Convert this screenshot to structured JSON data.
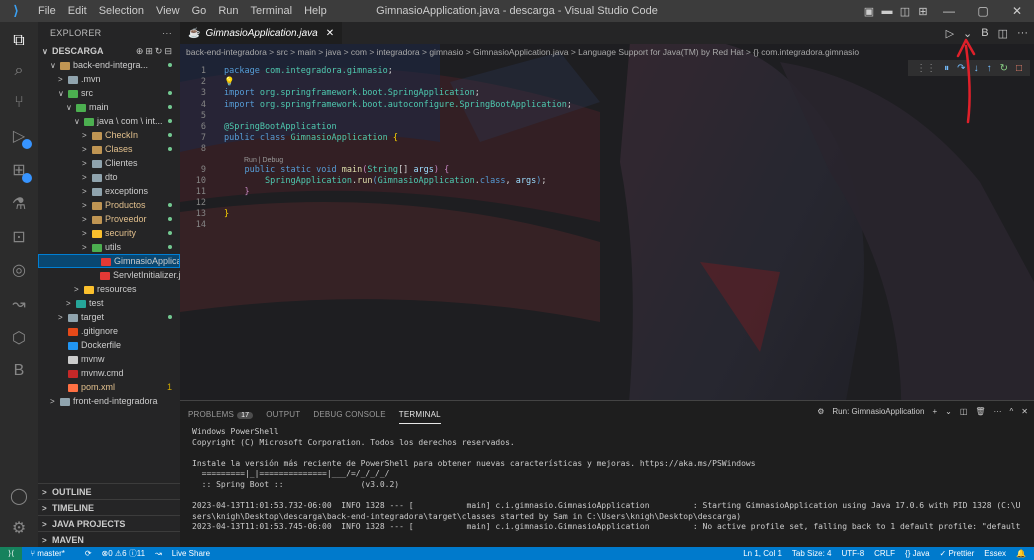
{
  "titlebar": {
    "menu": [
      "File",
      "Edit",
      "Selection",
      "View",
      "Go",
      "Run",
      "Terminal",
      "Help"
    ],
    "title": "GimnasioApplication.java - descarga - Visual Studio Code"
  },
  "sidebar": {
    "header": "EXPLORER",
    "more": "···",
    "tree": [
      {
        "label": "DESCARGA",
        "depth": 0,
        "chev": "∨",
        "section": true
      },
      {
        "label": "back-end-integra...",
        "depth": 1,
        "chev": "∨",
        "icon": "#c09553",
        "dot": true
      },
      {
        "label": ".mvn",
        "depth": 2,
        "chev": ">",
        "icon": "#90a4ae"
      },
      {
        "label": "src",
        "depth": 2,
        "chev": "∨",
        "icon": "#4caf50",
        "dot": true
      },
      {
        "label": "main",
        "depth": 3,
        "chev": "∨",
        "icon": "#4caf50",
        "dot": true
      },
      {
        "label": "java \\ com \\ int...",
        "depth": 4,
        "chev": "∨",
        "icon": "#4caf50",
        "dot": true
      },
      {
        "label": "CheckIn",
        "depth": 5,
        "chev": ">",
        "icon": "#c09553",
        "cls": "txt-orange",
        "dot": true
      },
      {
        "label": "Clases",
        "depth": 5,
        "chev": ">",
        "icon": "#c09553",
        "cls": "txt-orange",
        "dot": true
      },
      {
        "label": "Clientes",
        "depth": 5,
        "chev": ">",
        "icon": "#90a4ae"
      },
      {
        "label": "dto",
        "depth": 5,
        "chev": ">",
        "icon": "#90a4ae"
      },
      {
        "label": "exceptions",
        "depth": 5,
        "chev": ">",
        "icon": "#90a4ae"
      },
      {
        "label": "Productos",
        "depth": 5,
        "chev": ">",
        "icon": "#c09553",
        "cls": "txt-orange",
        "dot": true
      },
      {
        "label": "Proveedor",
        "depth": 5,
        "chev": ">",
        "icon": "#c09553",
        "cls": "txt-orange",
        "dot": true
      },
      {
        "label": "security",
        "depth": 5,
        "chev": ">",
        "icon": "#fbc02d",
        "cls": "txt-orange",
        "dot": true
      },
      {
        "label": "utils",
        "depth": 5,
        "chev": ">",
        "icon": "#4caf50",
        "dot": true
      },
      {
        "label": "GimnasioApplicati...",
        "depth": 6,
        "chev": "",
        "icon": "#e53935",
        "selected": true
      },
      {
        "label": "ServletInitializer.java",
        "depth": 6,
        "chev": "",
        "icon": "#e53935"
      },
      {
        "label": "resources",
        "depth": 4,
        "chev": ">",
        "icon": "#fbc02d"
      },
      {
        "label": "test",
        "depth": 3,
        "chev": ">",
        "icon": "#26a69a"
      },
      {
        "label": "target",
        "depth": 2,
        "chev": ">",
        "icon": "#90a4ae",
        "dot": true
      },
      {
        "label": ".gitignore",
        "depth": 2,
        "chev": "",
        "icon": "#e64a19"
      },
      {
        "label": "Dockerfile",
        "depth": 2,
        "chev": "",
        "icon": "#2196f3"
      },
      {
        "label": "mvnw",
        "depth": 2,
        "chev": "",
        "icon": "#cccccc"
      },
      {
        "label": "mvnw.cmd",
        "depth": 2,
        "chev": "",
        "icon": "#c62828"
      },
      {
        "label": "pom.xml",
        "depth": 2,
        "chev": "",
        "icon": "#ff7043",
        "cls": "txt-orange",
        "num": "1"
      },
      {
        "label": "front-end-integradora",
        "depth": 1,
        "chev": ">",
        "icon": "#90a4ae"
      }
    ],
    "bottom": [
      "OUTLINE",
      "TIMELINE",
      "JAVA PROJECTS",
      "MAVEN"
    ]
  },
  "editor": {
    "tab": "GimnasioApplication.java",
    "breadcrumb": "back-end-integradora > src > main > java > com > integradora > gimnasio > GimnasioApplication.java > Language Support for Java(TM) by Red Hat > {} com.integradora.gimnasio",
    "lens": "Run | Debug",
    "lines": [
      {
        "n": "1",
        "html": "<span class=\"kw\">package</span> <span class=\"pk\">com.integradora.gimnasio</span><span class=\"pl\">;</span>"
      },
      {
        "n": "2",
        "html": "<span class=\"br\">💡</span>"
      },
      {
        "n": "3",
        "html": "<span class=\"kw\">import</span> <span class=\"pk\">org.springframework.boot.SpringApplication</span><span class=\"pl\">;</span>"
      },
      {
        "n": "4",
        "html": "<span class=\"kw\">import</span> <span class=\"pk\">org.springframework.boot.autoconfigure.SpringBootApplication</span><span class=\"pl\">;</span>"
      },
      {
        "n": "5",
        "html": ""
      },
      {
        "n": "6",
        "html": "<span class=\"an\">@SpringBootApplication</span>"
      },
      {
        "n": "7",
        "html": "<span class=\"kw\">public class</span> <span class=\"pk\">GimnasioApplication</span> <span class=\"br\">{</span>"
      },
      {
        "n": "8",
        "html": "",
        "lensAfter": true
      },
      {
        "n": "9",
        "html": "    <span class=\"kw\">public static void</span> <span class=\"fn\">main</span><span class=\"kw2\">(</span><span class=\"pk\">String</span><span class=\"pl\">[]</span> <span class=\"par\">args</span><span class=\"kw2\">)</span> <span class=\"kw2\">{</span>"
      },
      {
        "n": "10",
        "html": "        <span class=\"pk\">SpringApplication</span><span class=\"pl\">.</span><span class=\"fn\">run</span><span class=\"kw\">(</span><span class=\"pk\">GimnasioApplication</span><span class=\"pl\">.</span><span class=\"kw\">class</span><span class=\"pl\">, </span><span class=\"par\">args</span><span class=\"kw\">)</span><span class=\"pl\">;</span>"
      },
      {
        "n": "11",
        "html": "    <span class=\"kw2\">}</span>"
      },
      {
        "n": "12",
        "html": ""
      },
      {
        "n": "13",
        "html": "<span class=\"br\">}</span>"
      },
      {
        "n": "14",
        "html": ""
      }
    ]
  },
  "panel": {
    "tabs": [
      "PROBLEMS",
      "OUTPUT",
      "DEBUG CONSOLE",
      "TERMINAL"
    ],
    "problems_count": "17",
    "run_label": "Run: GimnasioApplication",
    "terminal": [
      "Windows PowerShell",
      "Copyright (C) Microsoft Corporation. Todos los derechos reservados.",
      "",
      "Instale la versión más reciente de PowerShell para obtener nuevas características y mejoras. https://aka.ms/PSWindows",
      "  =========|_|==============|___/=/_/_/_/",
      "  :: Spring Boot ::                (v3.0.2)",
      "",
      "2023-04-13T11:01:53.732-06:00  INFO 1328 --- [           main] c.i.gimnasio.GimnasioApplication         : Starting GimnasioApplication using Java 17.0.6 with PID 1328 (C:\\U",
      "sers\\knigh\\Desktop\\descarga\\back-end-integradora\\target\\classes started by Sam in C:\\Users\\knigh\\Desktop\\descarga)",
      "2023-04-13T11:01:53.745-06:00  INFO 1328 --- [           main] c.i.gimnasio.GimnasioApplication         : No active profile set, falling back to 1 default profile: \"default"
    ]
  },
  "statusbar": {
    "branch": "master*",
    "problems": "⊗0 ⚠6 ⓘ11",
    "liveshare": "Live Share",
    "position": "Ln 1, Col 1",
    "tabsize": "Tab Size: 4",
    "encoding": "UTF-8",
    "eol": "CRLF",
    "lang": "{} Java",
    "prettier": "✓ Prettier",
    "user": "Essex"
  },
  "colors": {
    "accent": "#007acc",
    "selection": "#094771",
    "annotation": "#e0202a"
  }
}
